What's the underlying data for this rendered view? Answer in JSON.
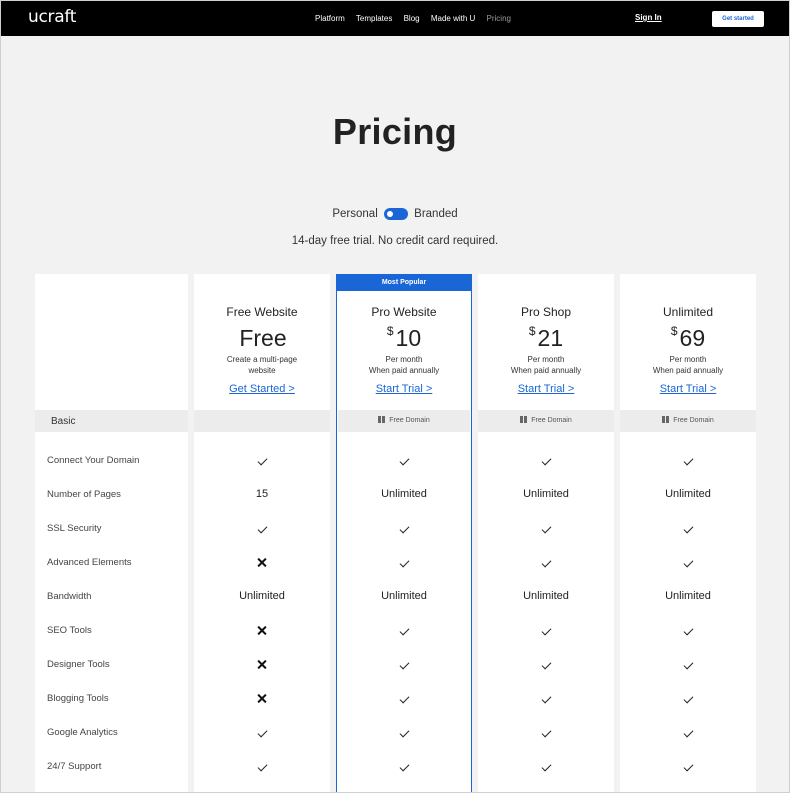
{
  "header": {
    "logo": "ucraft",
    "nav": [
      "Platform",
      "Templates",
      "Blog",
      "Made with U",
      "Pricing"
    ],
    "sign_in": "Sign In",
    "get_started": "Get started"
  },
  "hero": {
    "title": "Pricing",
    "toggle_left": "Personal",
    "toggle_right": "Branded",
    "trial_note": "14-day free trial. No credit card required."
  },
  "popular_badge": "Most Popular",
  "plans": [
    {
      "name": "Free Website",
      "currency": "",
      "price": "Free",
      "desc1": "Create a multi-page",
      "desc2": "website",
      "cta": "Get Started >",
      "section_note": ""
    },
    {
      "name": "Pro Website",
      "currency": "$",
      "price": "10",
      "desc1": "Per month",
      "desc2": "When paid annually",
      "cta": "Start Trial >",
      "section_note": "Free Domain"
    },
    {
      "name": "Pro Shop",
      "currency": "$",
      "price": "21",
      "desc1": "Per month",
      "desc2": "When paid annually",
      "cta": "Start Trial >",
      "section_note": "Free Domain"
    },
    {
      "name": "Unlimited",
      "currency": "$",
      "price": "69",
      "desc1": "Per month",
      "desc2": "When paid annually",
      "cta": "Start Trial >",
      "section_note": "Free Domain"
    }
  ],
  "section": {
    "label": "Basic"
  },
  "features": [
    {
      "label": "Connect Your Domain",
      "values": [
        "check",
        "check",
        "check",
        "check"
      ]
    },
    {
      "label": "Number of Pages",
      "values": [
        "15",
        "Unlimited",
        "Unlimited",
        "Unlimited"
      ]
    },
    {
      "label": "SSL Security",
      "values": [
        "check",
        "check",
        "check",
        "check"
      ]
    },
    {
      "label": "Advanced Elements",
      "values": [
        "cross",
        "check",
        "check",
        "check"
      ]
    },
    {
      "label": "Bandwidth",
      "values": [
        "Unlimited",
        "Unlimited",
        "Unlimited",
        "Unlimited"
      ]
    },
    {
      "label": "SEO Tools",
      "values": [
        "cross",
        "check",
        "check",
        "check"
      ]
    },
    {
      "label": "Designer Tools",
      "values": [
        "cross",
        "check",
        "check",
        "check"
      ]
    },
    {
      "label": "Blogging Tools",
      "values": [
        "cross",
        "check",
        "check",
        "check"
      ]
    },
    {
      "label": "Google Analytics",
      "values": [
        "check",
        "check",
        "check",
        "check"
      ]
    },
    {
      "label": "24/7 Support",
      "values": [
        "check",
        "check",
        "check",
        "check"
      ]
    }
  ],
  "colors": {
    "accent": "#1a66d6",
    "header_bg": "#000000",
    "page_bg": "#f2f2f2"
  }
}
